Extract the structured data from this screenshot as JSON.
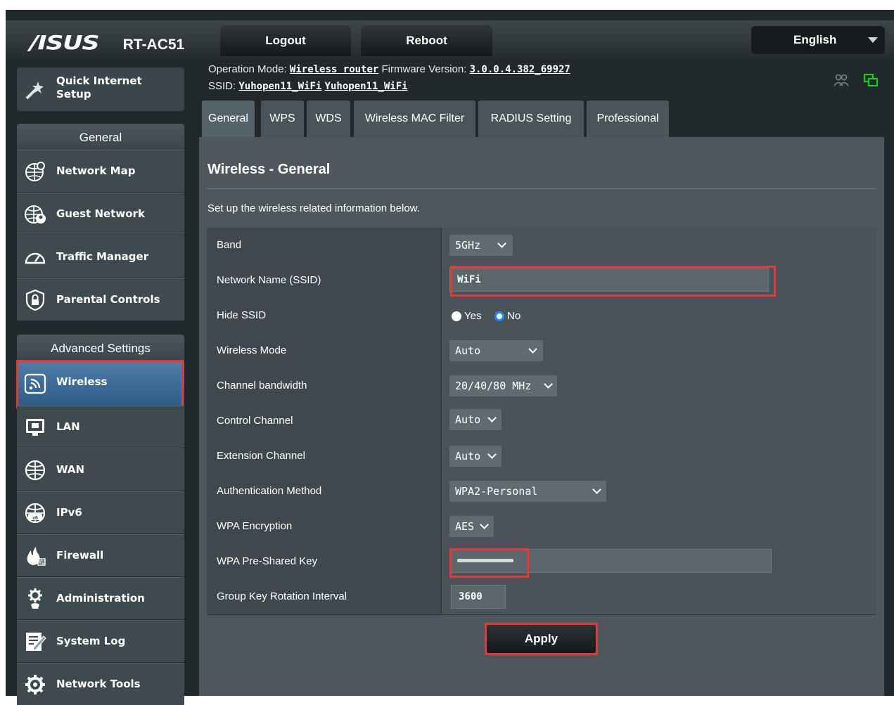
{
  "header": {
    "brand": "/ISUS",
    "model": "RT-AC51",
    "logout_label": "Logout",
    "reboot_label": "Reboot",
    "language": "English"
  },
  "sidebar": {
    "quick_setup_label_1": "Quick Internet",
    "quick_setup_label_2": "Setup",
    "general_header": "General",
    "general_items": [
      {
        "label": "Network Map",
        "icon": "network-map-icon"
      },
      {
        "label": "Guest Network",
        "icon": "guest-network-icon"
      },
      {
        "label": "Traffic Manager",
        "icon": "gauge-icon"
      },
      {
        "label": "Parental Controls",
        "icon": "lock-shield-icon"
      }
    ],
    "advanced_header": "Advanced Settings",
    "advanced_items": [
      {
        "label": "Wireless",
        "icon": "wifi-icon",
        "active": true
      },
      {
        "label": "LAN",
        "icon": "monitor-icon"
      },
      {
        "label": "WAN",
        "icon": "globe-icon"
      },
      {
        "label": "IPv6",
        "icon": "ipv6-globe-icon"
      },
      {
        "label": "Firewall",
        "icon": "fire-icon"
      },
      {
        "label": "Administration",
        "icon": "gear-icon"
      },
      {
        "label": "System Log",
        "icon": "log-icon"
      },
      {
        "label": "Network Tools",
        "icon": "tools-gear-icon"
      }
    ]
  },
  "status": {
    "operation_mode_label": "Operation Mode:",
    "operation_mode": "Wireless router",
    "firmware_label": "Firmware Version:",
    "firmware": "3.0.0.4.382_69927",
    "ssid_label": "SSID:",
    "ssid_1": "Yuhopen11_WiFi",
    "ssid_2": "Yuhopen11_WiFi"
  },
  "tabs": [
    "General",
    "WPS",
    "WDS",
    "Wireless MAC Filter",
    "RADIUS Setting",
    "Professional"
  ],
  "page": {
    "title": "Wireless - General",
    "description": "Set up the wireless related information below."
  },
  "form": {
    "band_label": "Band",
    "band_value": "5GHz",
    "ssid_label": "Network Name (SSID)",
    "ssid_value": "WiFi",
    "hide_ssid_label": "Hide SSID",
    "hide_yes": "Yes",
    "hide_no": "No",
    "mode_label": "Wireless Mode",
    "mode_value": "Auto",
    "bandwidth_label": "Channel bandwidth",
    "bandwidth_value": "20/40/80 MHz",
    "control_label": "Control Channel",
    "control_value": "Auto",
    "extension_label": "Extension Channel",
    "extension_value": "Auto",
    "auth_label": "Authentication Method",
    "auth_value": "WPA2-Personal",
    "encryption_label": "WPA Encryption",
    "encryption_value": "AES",
    "psk_label": "WPA Pre-Shared Key",
    "rotation_label": "Group Key Rotation Interval",
    "rotation_value": "3600",
    "apply_label": "Apply"
  },
  "colors": {
    "highlight": "#e0393e",
    "active_item": "#3a6a98"
  }
}
